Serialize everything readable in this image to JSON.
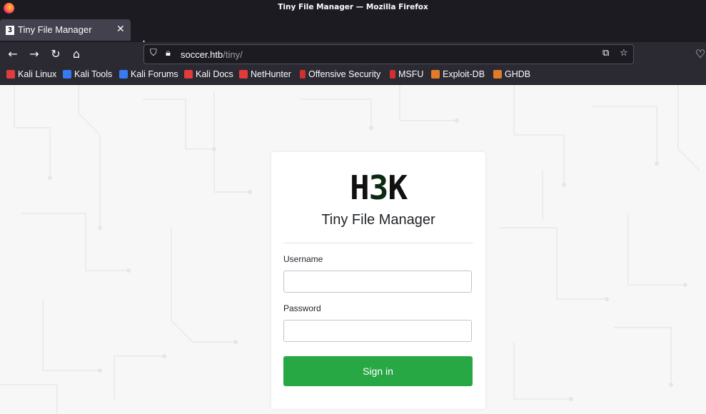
{
  "window": {
    "title": "Tiny File Manager — Mozilla Firefox"
  },
  "tab": {
    "label": "Tiny File Manager",
    "favicon_char": "3"
  },
  "nav": {
    "url_host": "soccer.htb",
    "url_path": "/tiny/",
    "icons": [
      "back-icon",
      "forward-icon",
      "reload-icon",
      "home-icon",
      "shield-icon",
      "lock-icon",
      "translate-icon",
      "star-icon",
      "pocket-icon"
    ]
  },
  "bookmarks": [
    {
      "label": "Kali Linux",
      "color": "#e23b3b"
    },
    {
      "label": "Kali Tools",
      "color": "#367bf0"
    },
    {
      "label": "Kali Forums",
      "color": "#367bf0"
    },
    {
      "label": "Kali Docs",
      "color": "#e23b3b"
    },
    {
      "label": "NetHunter",
      "color": "#e23b3b"
    },
    {
      "label": "Offensive Security",
      "color": "#d22f2f"
    },
    {
      "label": "MSFU",
      "color": "#d22f2f"
    },
    {
      "label": "Exploit-DB",
      "color": "#e07b2a"
    },
    {
      "label": "GHDB",
      "color": "#e07b2a"
    }
  ],
  "login": {
    "logo_left": "H",
    "logo_mid": "3",
    "logo_right": "K",
    "title": "Tiny File Manager",
    "username_label": "Username",
    "username_value": "",
    "password_label": "Password",
    "password_value": "",
    "submit_label": "Sign in"
  },
  "colors": {
    "accent": "#28a745",
    "chrome_dark": "#1c1b22",
    "chrome": "#2b2a33"
  }
}
